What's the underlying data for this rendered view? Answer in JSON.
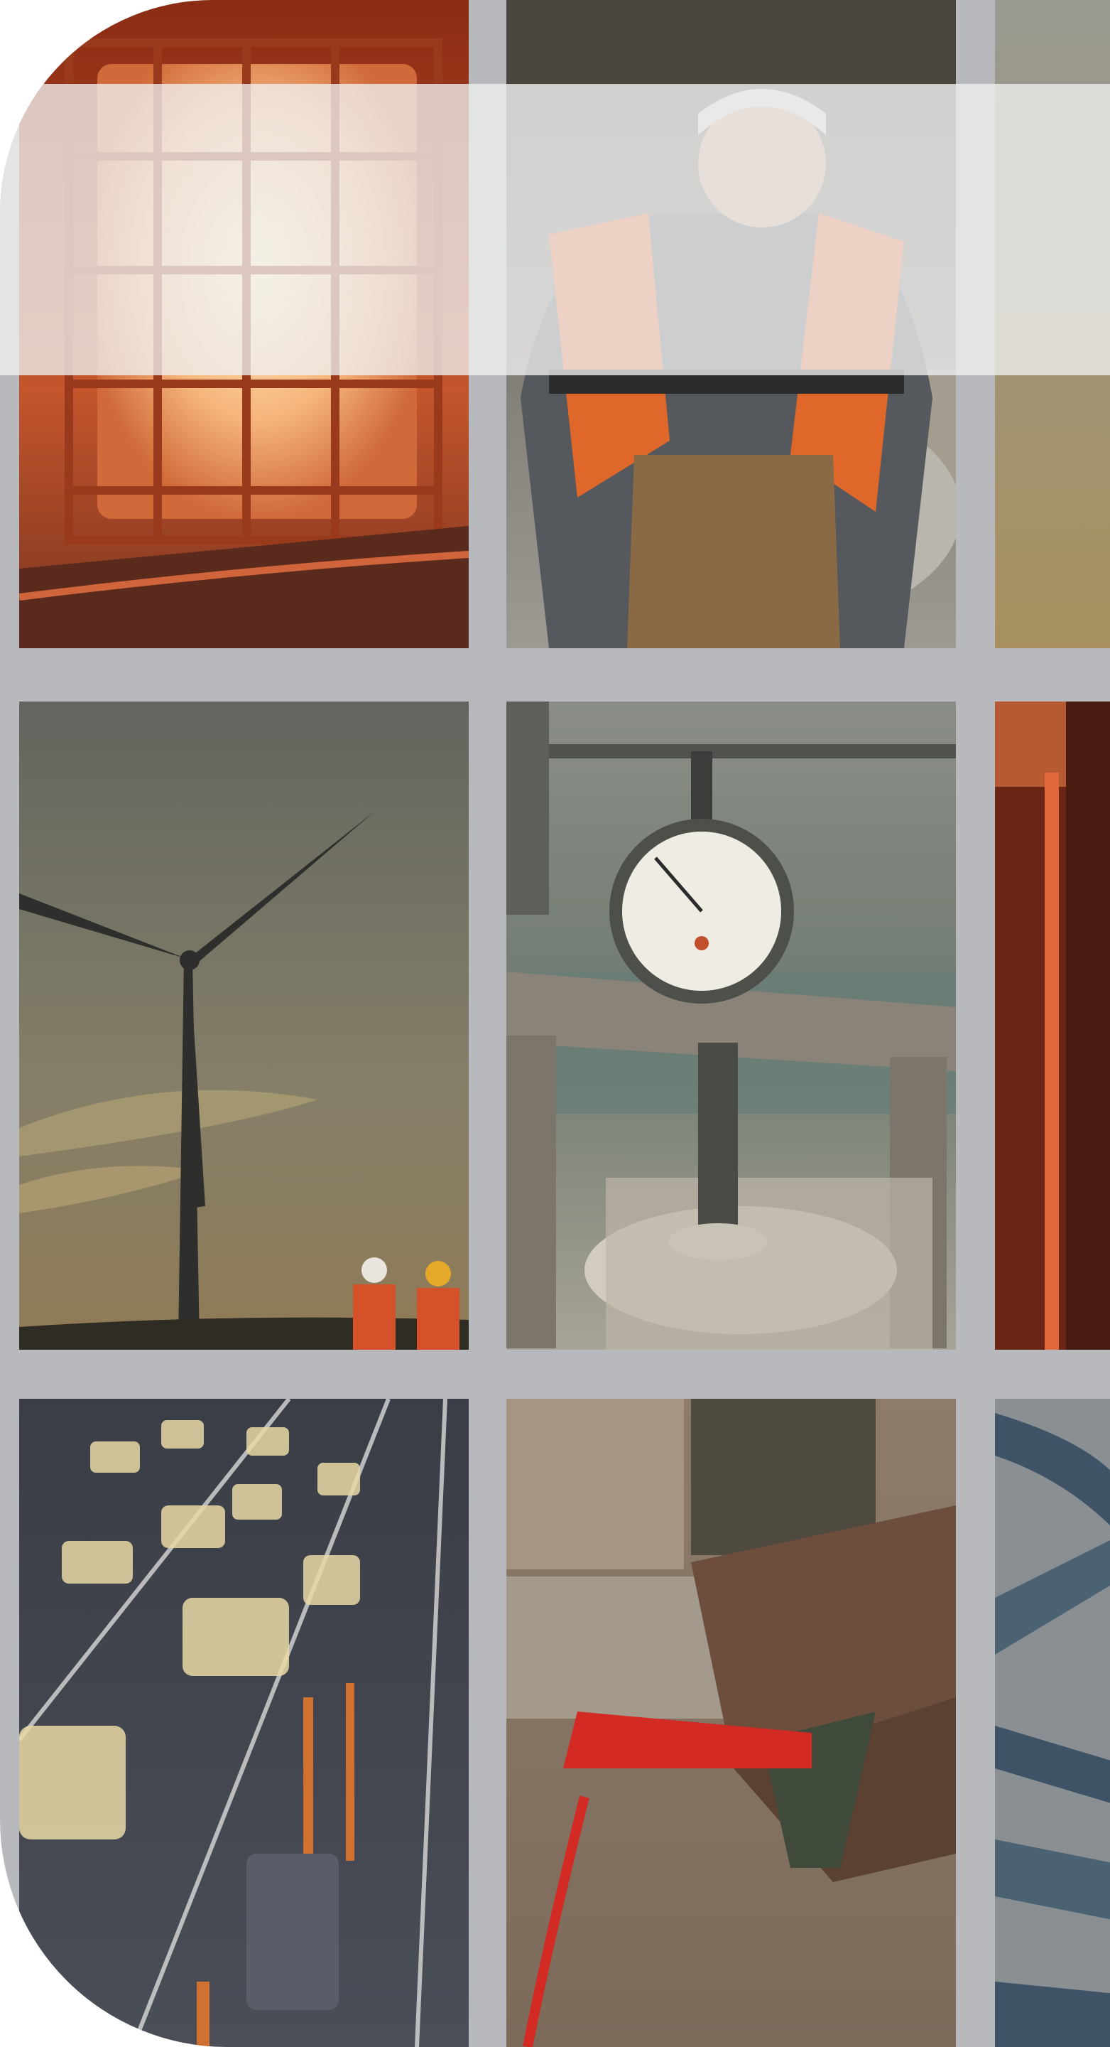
{
  "collage": {
    "background_color": "#b7b9bc",
    "tiles": [
      {
        "subject": "radiant-heater",
        "tone": "#c65a2e"
      },
      {
        "subject": "worker-in-safety-vest",
        "tone": "#7c776b"
      },
      {
        "subject": "blurred-backdrop",
        "tone": "#a69a7d"
      },
      {
        "subject": "wind-turbine-at-dusk",
        "tone": "#6f6a58"
      },
      {
        "subject": "dial-gauge-on-test-rig",
        "tone": "#8a857b"
      },
      {
        "subject": "heating-element",
        "tone": "#8b3a1f"
      },
      {
        "subject": "highway-traffic-motion",
        "tone": "#3c414a"
      },
      {
        "subject": "steel-rail-with-test-clamp",
        "tone": "#7a6656"
      },
      {
        "subject": "highway-interchange-aerial",
        "tone": "#4c6273"
      }
    ]
  },
  "banner": {
    "color": "#f0f0f0"
  }
}
